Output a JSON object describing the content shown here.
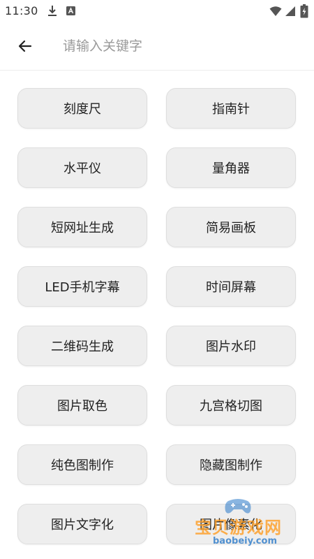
{
  "status_bar": {
    "time": "11:30",
    "icons": [
      "download-icon",
      "app-notification-icon",
      "wifi-icon",
      "cell-signal-icon",
      "battery-charging-icon"
    ]
  },
  "search": {
    "placeholder": "请输入关键字",
    "value": ""
  },
  "icons": {
    "back": "arrow-left-icon"
  },
  "tools": [
    {
      "label": "刻度尺"
    },
    {
      "label": "指南针"
    },
    {
      "label": "水平仪"
    },
    {
      "label": "量角器"
    },
    {
      "label": "短网址生成"
    },
    {
      "label": "简易画板"
    },
    {
      "label": "LED手机字幕"
    },
    {
      "label": "时间屏幕"
    },
    {
      "label": "二维码生成"
    },
    {
      "label": "图片水印"
    },
    {
      "label": "图片取色"
    },
    {
      "label": "九宫格切图"
    },
    {
      "label": "纯色图制作"
    },
    {
      "label": "隐藏图制作"
    },
    {
      "label": "图片文字化"
    },
    {
      "label": "图片像素化"
    }
  ],
  "watermark": {
    "name": "宝贝游戏网",
    "domain": "baobeiy.com"
  },
  "colors": {
    "button_bg": "#eeeeee",
    "button_border": "#dedede",
    "text": "#222222",
    "placeholder": "#9a9a9a",
    "watermark_orange": "#ff9b1e",
    "watermark_blue": "#2878c8"
  }
}
